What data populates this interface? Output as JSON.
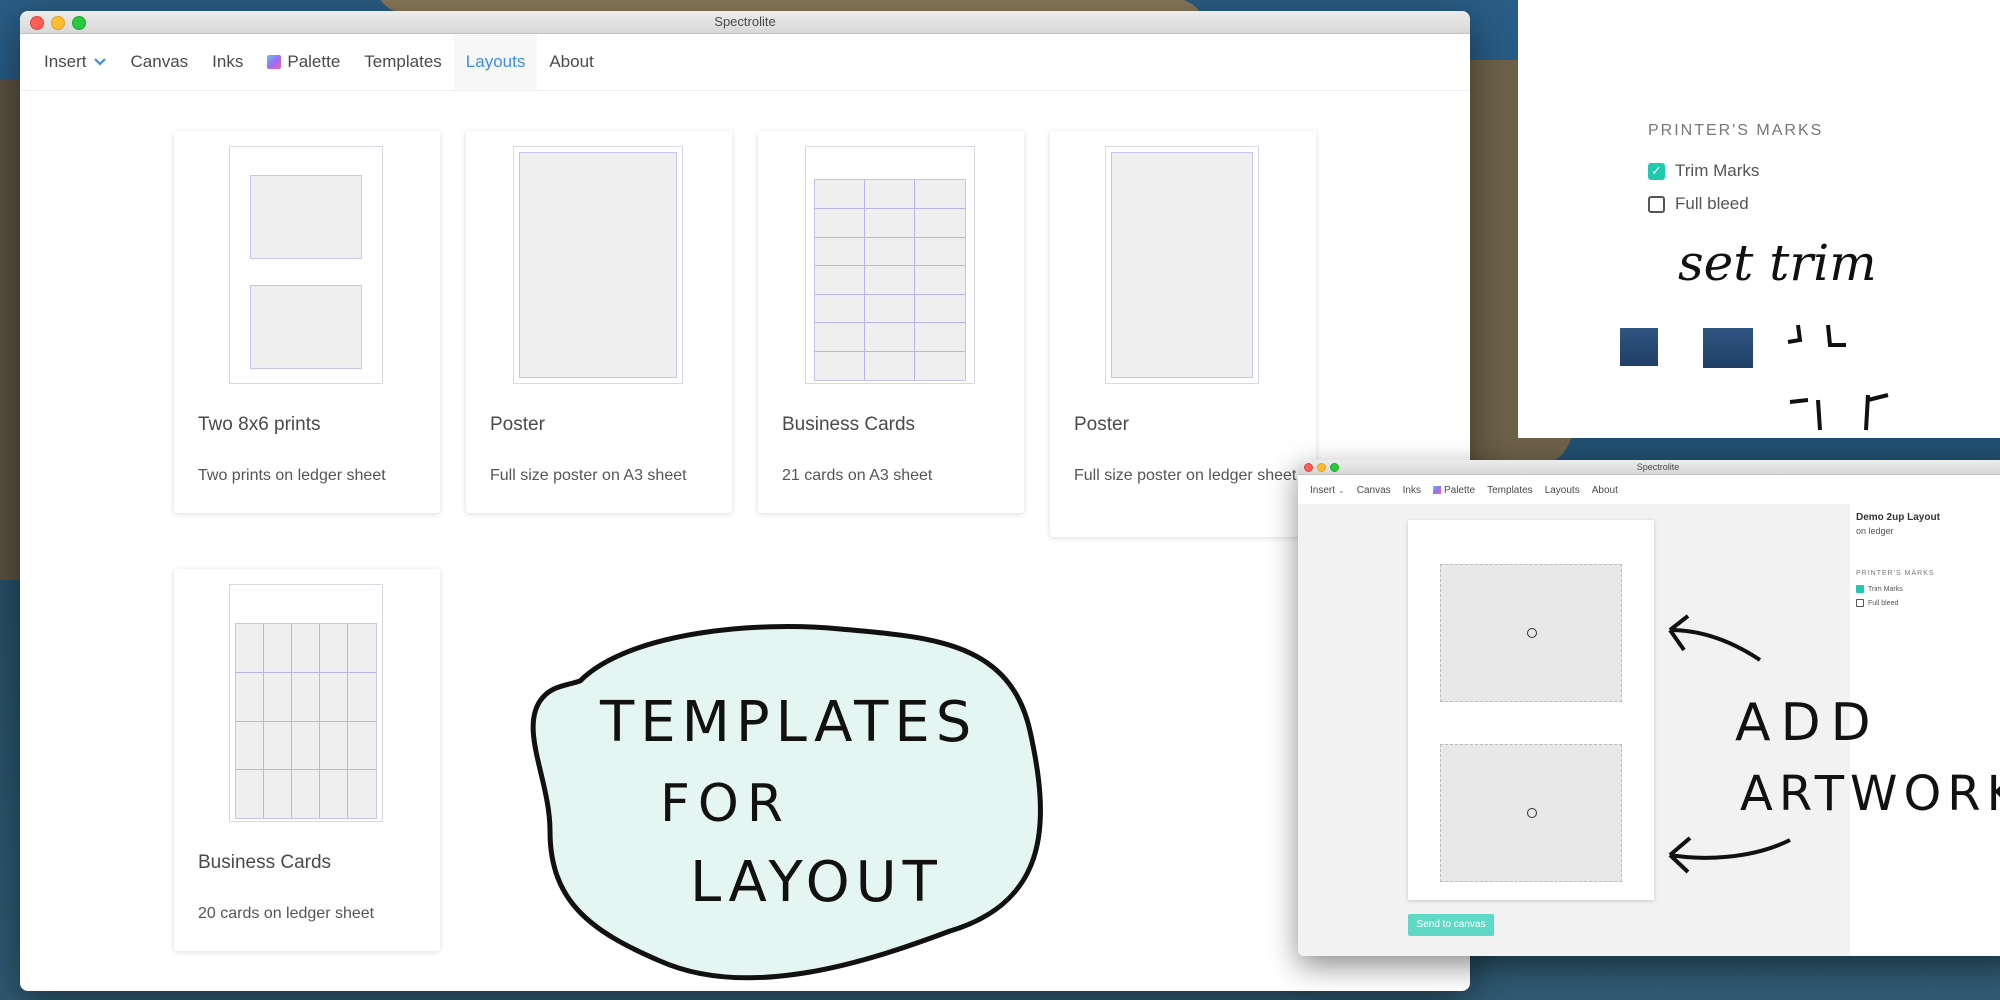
{
  "window": {
    "title": "Spectrolite"
  },
  "menu": {
    "items": [
      {
        "label": "Insert"
      },
      {
        "label": "Canvas"
      },
      {
        "label": "Inks"
      },
      {
        "label": "Palette"
      },
      {
        "label": "Templates"
      },
      {
        "label": "Layouts"
      },
      {
        "label": "About"
      }
    ],
    "active": "Layouts"
  },
  "templates": [
    {
      "title": "Two 8x6 prints",
      "description": "Two prints on ledger sheet"
    },
    {
      "title": "Poster",
      "description": "Full size poster on A3 sheet"
    },
    {
      "title": "Business Cards",
      "description": "21 cards on A3 sheet"
    },
    {
      "title": "Poster",
      "description": "Full size poster on ledger sheet"
    },
    {
      "title": "Business Cards",
      "description": "20 cards on ledger sheet"
    }
  ],
  "printers_marks": {
    "title": "PRINTER'S MARKS",
    "options": [
      {
        "label": "Trim Marks",
        "checked": true
      },
      {
        "label": "Full bleed",
        "checked": false
      }
    ]
  },
  "annotations": {
    "templates_note": [
      "TEMPLATES",
      "FOR",
      "LAYOUT"
    ],
    "set_trim": "set trim",
    "add_artwork": [
      "ADD",
      "ARTWORK"
    ]
  },
  "layout_window": {
    "title": "Spectrolite",
    "menu": [
      "Insert",
      "Canvas",
      "Inks",
      "Palette",
      "Templates",
      "Layouts",
      "About"
    ],
    "layout_name": "Demo 2up Layout",
    "layout_sheet": "on ledger",
    "marks_title": "PRINTER'S MARKS",
    "marks": [
      {
        "label": "Trim Marks",
        "checked": true
      },
      {
        "label": "Full bleed",
        "checked": false
      }
    ],
    "send_button": "Send to canvas"
  },
  "colors": {
    "accent": "#3d8ee0",
    "check": "#1fc9b0",
    "send": "#5fd9c5"
  }
}
